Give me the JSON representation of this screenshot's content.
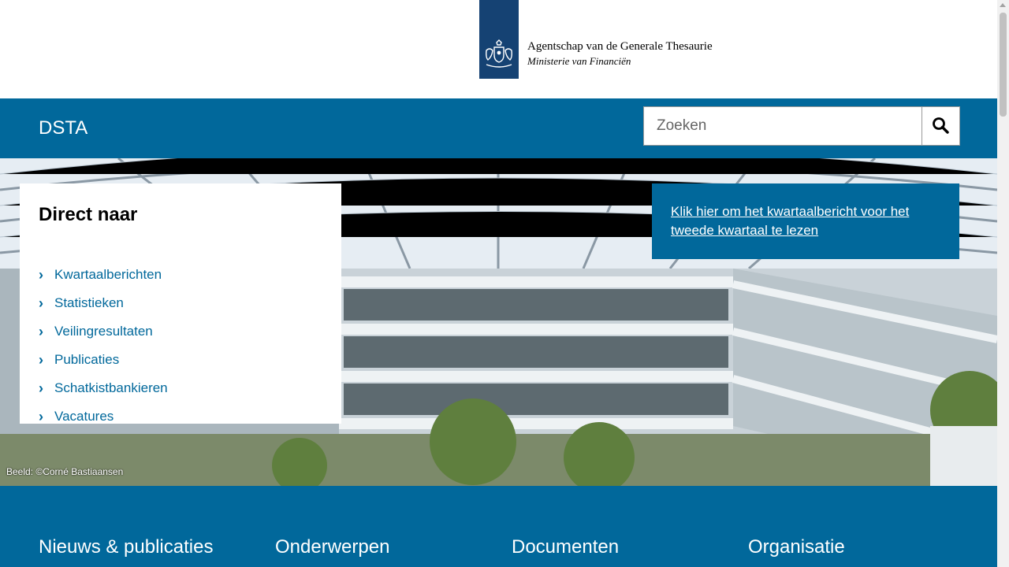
{
  "header": {
    "logo_line1": "Agentschap van de Generale Thesaurie",
    "logo_line2": "Ministerie van Financiën",
    "emblem_icon": "dutch-coat-of-arms-icon"
  },
  "nav": {
    "site_name": "DSTA",
    "search_placeholder": "Zoeken",
    "search_value": "",
    "search_icon": "magnifier-icon"
  },
  "hero": {
    "credit": "Beeld: ©Corné Bastiaansen",
    "direct": {
      "title": "Direct naar",
      "items": [
        {
          "label": "Kwartaalberichten"
        },
        {
          "label": "Statistieken"
        },
        {
          "label": "Veilingresultaten"
        },
        {
          "label": "Publicaties"
        },
        {
          "label": "Schatkistbankieren"
        },
        {
          "label": "Vacatures"
        }
      ]
    },
    "promo_link": "Klik hier om het kwartaalbericht voor het tweede kwartaal te lezen"
  },
  "sections": [
    {
      "label": "Nieuws & publicaties"
    },
    {
      "label": "Onderwerpen"
    },
    {
      "label": "Documenten"
    },
    {
      "label": "Organisatie"
    }
  ],
  "colors": {
    "brand_blue": "#01689b",
    "logo_blue": "#154273"
  }
}
